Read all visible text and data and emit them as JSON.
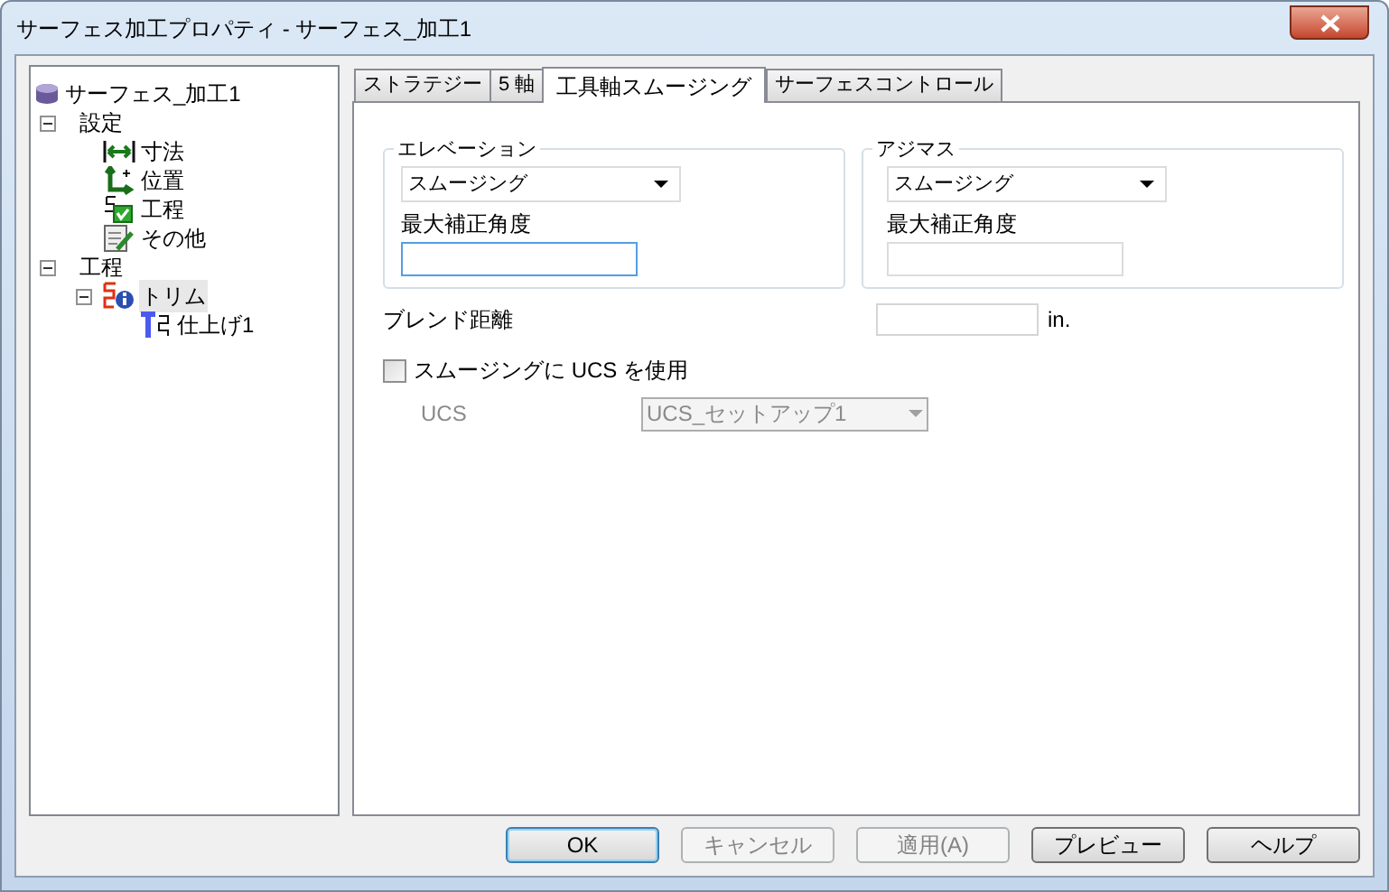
{
  "window": {
    "title": "サーフェス加工プロパティ - サーフェス_加工1"
  },
  "tree": [
    {
      "label": "サーフェス_加工1",
      "kind": "database",
      "selected": false,
      "children": [
        {
          "label": "設定",
          "kind": "folder",
          "selected": false,
          "expanded": true,
          "children": [
            {
              "label": "寸法",
              "kind": "dimension",
              "selected": false
            },
            {
              "label": "位置",
              "kind": "position",
              "selected": false
            },
            {
              "label": "工程",
              "kind": "process",
              "selected": false
            },
            {
              "label": "その他",
              "kind": "other",
              "selected": false
            }
          ]
        },
        {
          "label": "工程",
          "kind": "folder",
          "selected": false,
          "expanded": true,
          "children": [
            {
              "label": "トリム",
              "kind": "trim",
              "selected": true,
              "expanded": true,
              "children": [
                {
                  "label": "仕上げ1",
                  "kind": "finish",
                  "selected": false
                }
              ]
            }
          ]
        }
      ]
    }
  ],
  "tabs": [
    {
      "label": "ストラテジー",
      "selected": false
    },
    {
      "label": "5 軸",
      "selected": false
    },
    {
      "label": "工具軸スムージング",
      "selected": true
    },
    {
      "label": "サーフェスコントロール",
      "selected": false
    }
  ],
  "groups": [
    {
      "legend": "エレベーション",
      "dropdown": {
        "value": "スムージング"
      },
      "label": "最大補正角度",
      "input": {
        "focused": true
      }
    },
    {
      "legend": "アジマス",
      "dropdown": {
        "value": "スムージング"
      },
      "label": "最大補正角度",
      "input": {
        "focused": false
      }
    }
  ],
  "blend": {
    "label": "ブレンド距離",
    "unit": "in."
  },
  "checkbox": {
    "label": "スムージングに UCS を使用",
    "checked": false
  },
  "ucs": {
    "label": "UCS",
    "disabled": true,
    "dropdown": {
      "value": "UCS_セットアップ1"
    }
  },
  "buttons": [
    {
      "label": "OK",
      "default": true,
      "disabled": false
    },
    {
      "label": "キャンセル",
      "default": false,
      "disabled": true
    },
    {
      "label": "適用(A)",
      "default": false,
      "disabled": true
    },
    {
      "label": "プレビュー",
      "default": false,
      "disabled": false
    },
    {
      "label": "ヘルプ",
      "default": false,
      "disabled": false
    }
  ]
}
